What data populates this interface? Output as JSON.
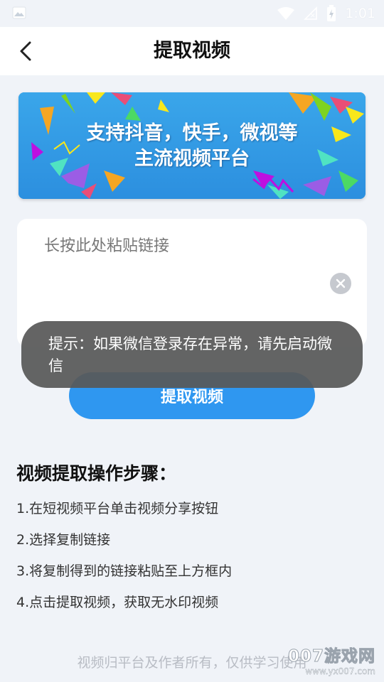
{
  "status_bar": {
    "time": "1:01",
    "icons": [
      "image-icon",
      "wifi-icon",
      "signal-icon",
      "battery-charging-icon"
    ]
  },
  "header": {
    "back_icon": "chevron-left-icon",
    "title": "提取视频"
  },
  "banner": {
    "line1": "支持抖音，快手，微视等",
    "line2": "主流视频平台",
    "background_color": "#2f9be6"
  },
  "input": {
    "placeholder": "长按此处粘贴链接",
    "clear_icon": "clear-circle-icon"
  },
  "toast": {
    "text": "提示：如果微信登录存在异常，请先启动微信"
  },
  "extract_button": {
    "label": "提取视频",
    "color": "#2f97f0"
  },
  "steps": {
    "title": "视频提取操作步骤：",
    "items": [
      "1.在短视频平台单击视频分享按钮",
      "2.选择复制链接",
      "3.将复制得到的链接粘贴至上方框内",
      "4.点击提取视频，获取无水印视频"
    ]
  },
  "footer": {
    "text": "视频归平台及作者所有，仅供学习使用"
  },
  "watermark": {
    "brand": "007游戏网",
    "url": "www.yx007.com"
  }
}
